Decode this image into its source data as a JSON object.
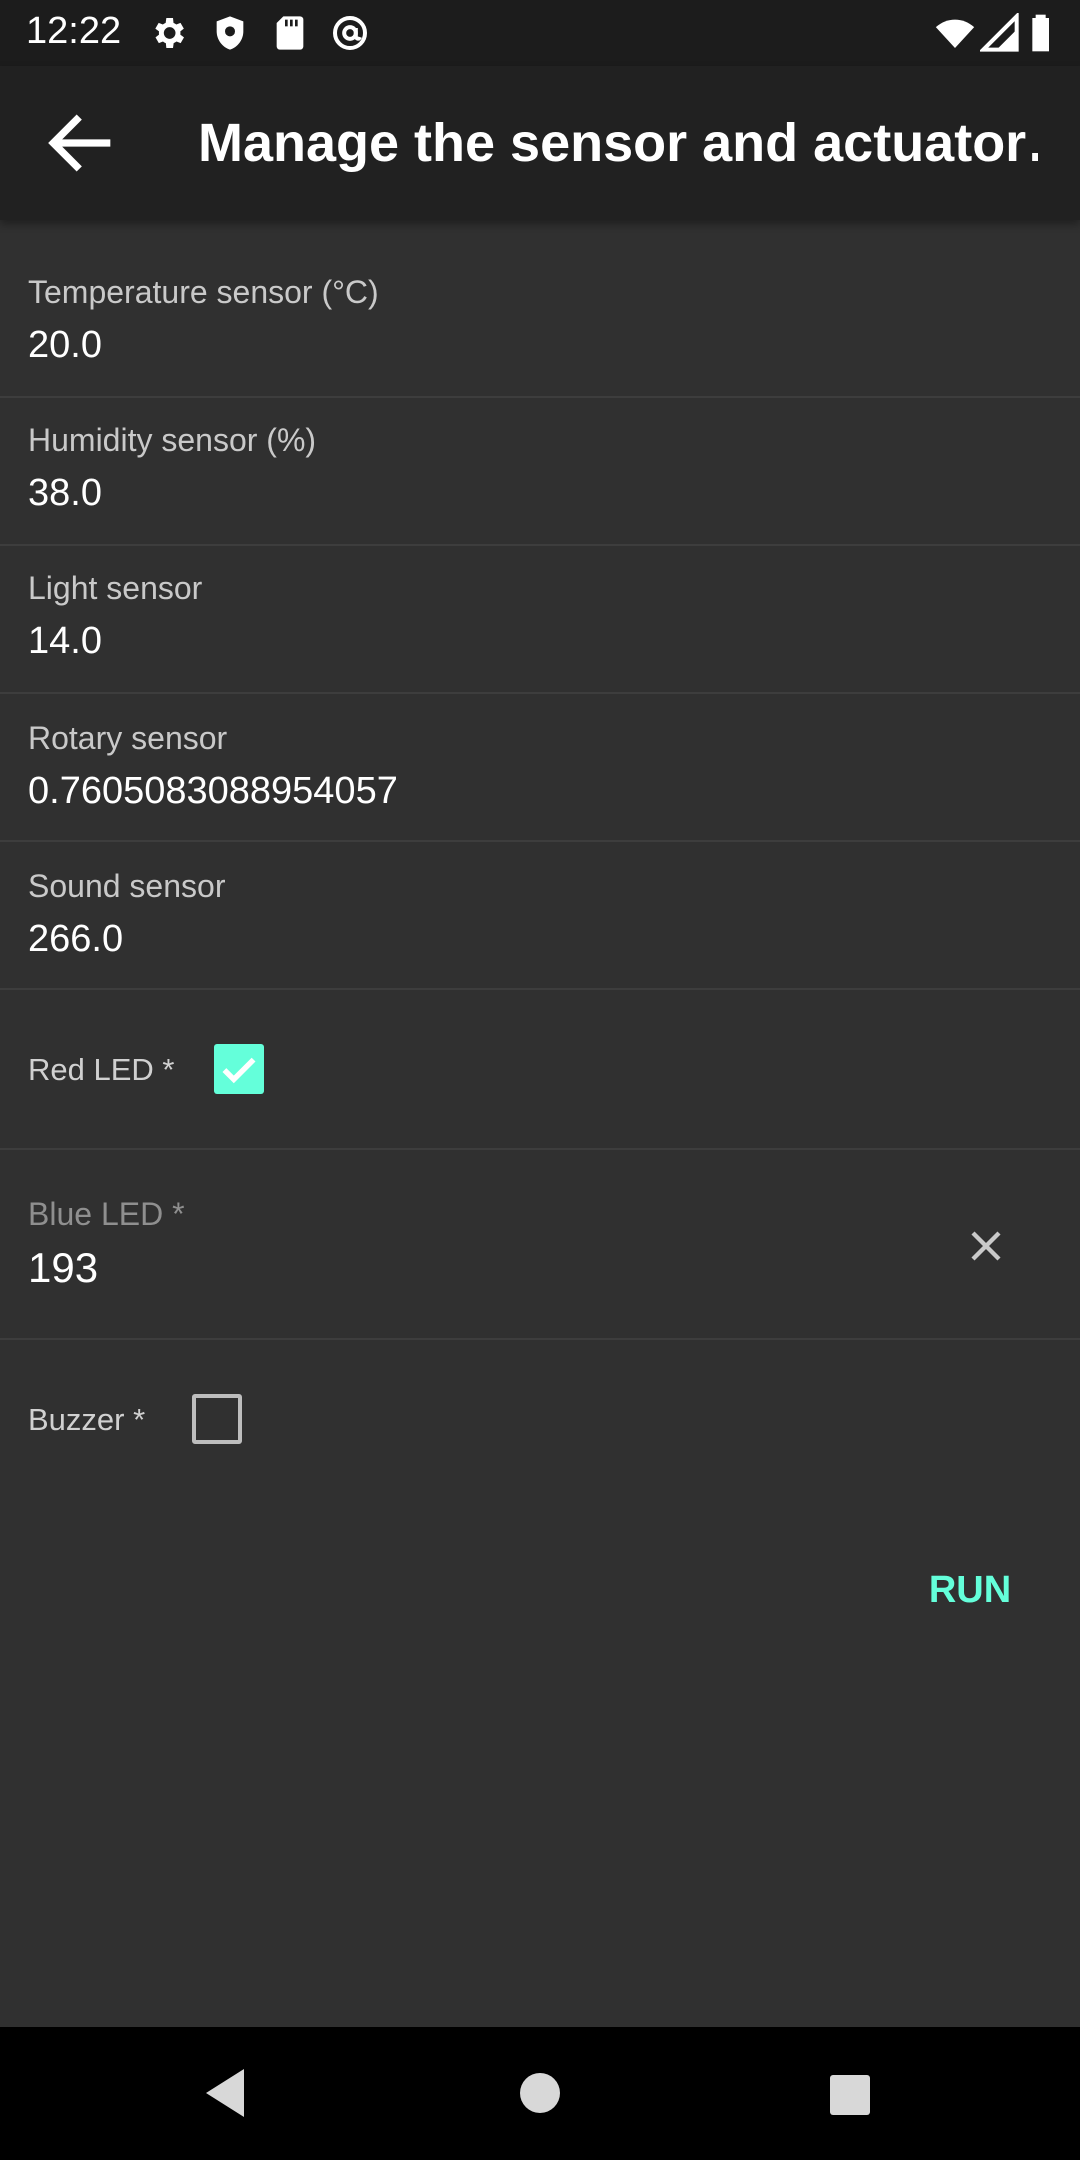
{
  "status_bar": {
    "time": "12:22",
    "left_icons": [
      "gear-icon",
      "shield-icon",
      "sd-card-icon",
      "at-sign-icon"
    ],
    "right_icons": [
      "wifi-icon",
      "cell-signal-icon",
      "battery-icon"
    ]
  },
  "app_bar": {
    "title": "Manage the sensor and actuator…"
  },
  "sensors": [
    {
      "label": "Temperature sensor (°C)",
      "value": "20.0"
    },
    {
      "label": "Humidity sensor (%)",
      "value": "38.0"
    },
    {
      "label": "Light sensor",
      "value": "14.0"
    },
    {
      "label": "Rotary sensor",
      "value": "0.7605083088954057"
    },
    {
      "label": "Sound sensor",
      "value": "266.0"
    }
  ],
  "actuators": {
    "red_led": {
      "label": "Red LED *",
      "checked": true
    },
    "blue_led": {
      "label": "Blue LED *",
      "value": "193"
    },
    "buzzer": {
      "label": "Buzzer *",
      "checked": false
    }
  },
  "actions": {
    "run_label": "RUN"
  },
  "colors": {
    "background": "#303030",
    "app_bar": "#212121",
    "accent": "#64ffda"
  }
}
